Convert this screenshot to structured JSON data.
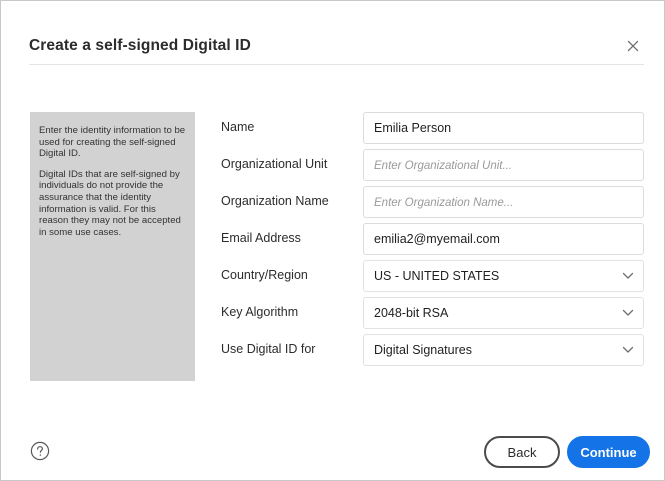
{
  "dialog": {
    "title": "Create a self-signed Digital ID"
  },
  "info": {
    "paragraph1": "Enter the identity information to be used for creating the self-signed Digital ID.",
    "paragraph2": "Digital IDs that are self-signed by individuals do not provide the assurance that the identity information is valid. For this reason they may not be accepted in some use cases."
  },
  "form": {
    "name": {
      "label": "Name",
      "value": "Emilia Person",
      "placeholder": ""
    },
    "org_unit": {
      "label": "Organizational Unit",
      "value": "",
      "placeholder": "Enter Organizational Unit..."
    },
    "org_name": {
      "label": "Organization Name",
      "value": "",
      "placeholder": "Enter Organization Name..."
    },
    "email": {
      "label": "Email Address",
      "value": "emilia2@myemail.com",
      "placeholder": ""
    },
    "country": {
      "label": "Country/Region",
      "value": "US - UNITED STATES"
    },
    "key_algorithm": {
      "label": "Key Algorithm",
      "value": "2048-bit RSA"
    },
    "use_for": {
      "label": "Use Digital ID for",
      "value": "Digital Signatures"
    }
  },
  "footer": {
    "back_label": "Back",
    "continue_label": "Continue"
  },
  "icons": {
    "close": "close-icon",
    "help": "help-icon",
    "chevron": "chevron-down-icon"
  },
  "colors": {
    "accent": "#1473e6",
    "info_panel_bg": "#d2d2d2"
  }
}
